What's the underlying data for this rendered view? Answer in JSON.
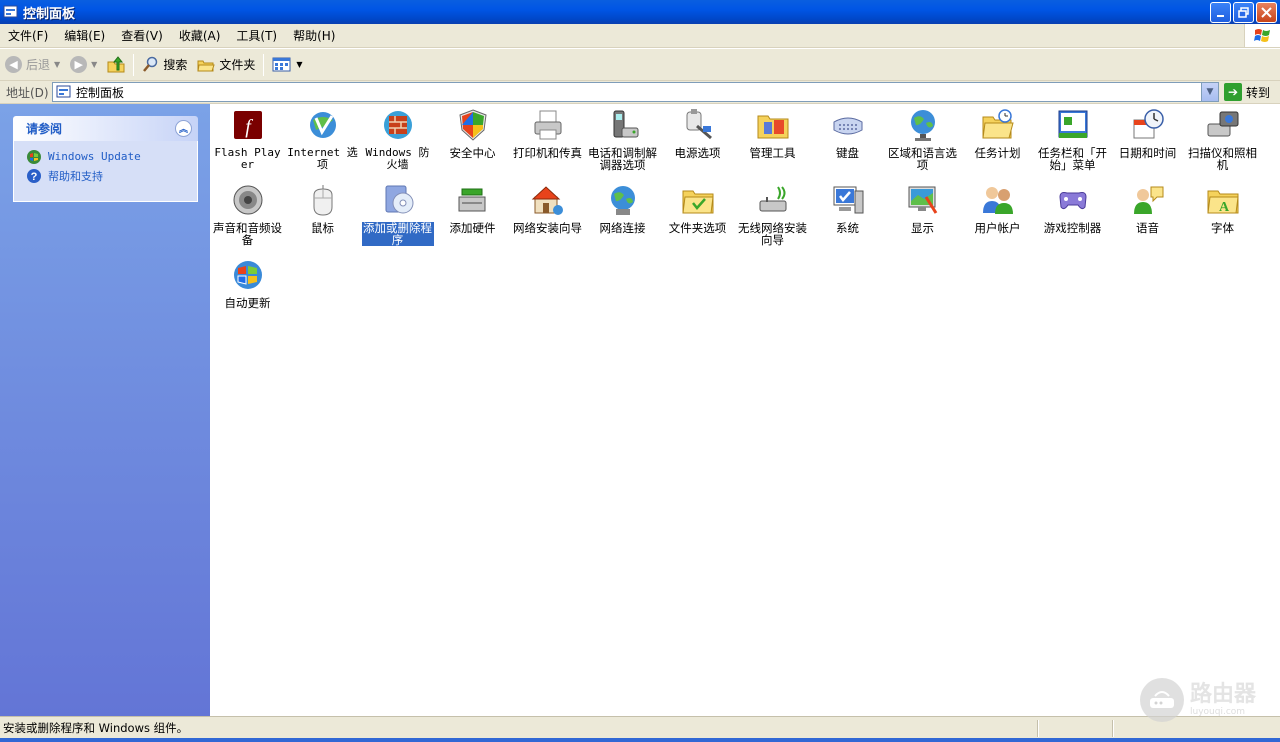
{
  "window": {
    "title": "控制面板",
    "buttons": [
      "minimize",
      "restore",
      "close"
    ]
  },
  "menu": {
    "items": [
      "文件(F)",
      "编辑(E)",
      "查看(V)",
      "收藏(A)",
      "工具(T)",
      "帮助(H)"
    ]
  },
  "toolbar": {
    "back_label": "后退",
    "search_label": "搜索",
    "folders_label": "文件夹"
  },
  "address": {
    "label": "地址(D)",
    "value": "控制面板",
    "go_label": "转到"
  },
  "sidebar": {
    "panel_title": "请参阅",
    "links": [
      {
        "label": "Windows Update",
        "icon": "windows-update-icon"
      },
      {
        "label": "帮助和支持",
        "icon": "help-icon"
      }
    ]
  },
  "items": [
    {
      "label": "Flash Player",
      "icon": "flash-player-icon"
    },
    {
      "label": "Internet 选项",
      "icon": "internet-options-icon"
    },
    {
      "label": "Windows 防火墙",
      "icon": "firewall-icon"
    },
    {
      "label": "安全中心",
      "icon": "security-center-icon"
    },
    {
      "label": "打印机和传真",
      "icon": "printer-icon"
    },
    {
      "label": "电话和调制解调器选项",
      "icon": "phone-modem-icon"
    },
    {
      "label": "电源选项",
      "icon": "power-options-icon"
    },
    {
      "label": "管理工具",
      "icon": "admin-tools-icon"
    },
    {
      "label": "键盘",
      "icon": "keyboard-icon"
    },
    {
      "label": "区域和语言选项",
      "icon": "region-language-icon"
    },
    {
      "label": "任务计划",
      "icon": "scheduled-tasks-icon"
    },
    {
      "label": "任务栏和「开始」菜单",
      "icon": "taskbar-icon"
    },
    {
      "label": "日期和时间",
      "icon": "date-time-icon"
    },
    {
      "label": "扫描仪和照相机",
      "icon": "scanner-camera-icon"
    },
    {
      "label": "声音和音频设备",
      "icon": "sound-icon"
    },
    {
      "label": "鼠标",
      "icon": "mouse-icon"
    },
    {
      "label": "添加或删除程序",
      "icon": "add-remove-programs-icon",
      "selected": true
    },
    {
      "label": "添加硬件",
      "icon": "add-hardware-icon"
    },
    {
      "label": "网络安装向导",
      "icon": "network-setup-icon"
    },
    {
      "label": "网络连接",
      "icon": "network-connections-icon"
    },
    {
      "label": "文件夹选项",
      "icon": "folder-options-icon"
    },
    {
      "label": "无线网络安装向导",
      "icon": "wireless-setup-icon"
    },
    {
      "label": "系统",
      "icon": "system-icon"
    },
    {
      "label": "显示",
      "icon": "display-icon"
    },
    {
      "label": "用户帐户",
      "icon": "user-accounts-icon"
    },
    {
      "label": "游戏控制器",
      "icon": "game-controller-icon"
    },
    {
      "label": "语音",
      "icon": "speech-icon"
    },
    {
      "label": "字体",
      "icon": "fonts-icon"
    },
    {
      "label": "自动更新",
      "icon": "automatic-updates-icon"
    }
  ],
  "status": {
    "message": "安装或删除程序和 Windows 组件。"
  },
  "watermark": {
    "big": "路由器",
    "small": "luyouqi.com"
  }
}
